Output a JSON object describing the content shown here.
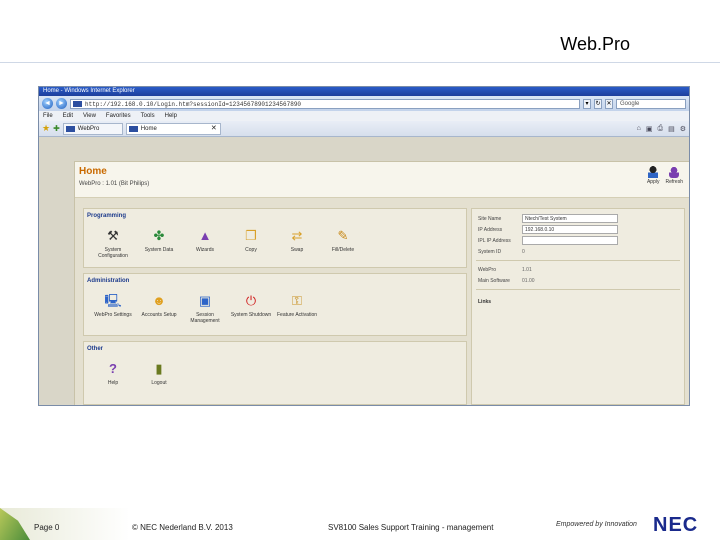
{
  "slide": {
    "title": "Web.Pro",
    "footer": {
      "page": "Page 0",
      "copyright": "© NEC Nederland B.V.  2013",
      "training": "SV8100 Sales Support Training - management",
      "tagline": "Empowered by Innovation",
      "logo": "NEC"
    }
  },
  "browser": {
    "window_title": "Home - Windows Internet Explorer",
    "url": "http://192.168.0.10/Login.htm?sessionId=12345678901234567890",
    "search_placeholder": "Google",
    "menu": [
      "File",
      "Edit",
      "View",
      "Favorites",
      "Tools",
      "Help"
    ],
    "tabs": [
      {
        "label": "WebPro"
      },
      {
        "label": "Home"
      }
    ]
  },
  "page": {
    "title": "Home",
    "subtitle": "WebPro : 1.01 (Bit Philips)",
    "actions": {
      "apply": "Apply",
      "refresh": "Refresh"
    },
    "programming": {
      "title": "Programming",
      "items": [
        {
          "label": "System Configuration",
          "icon": "tools-icon"
        },
        {
          "label": "System Data",
          "icon": "blocks-icon"
        },
        {
          "label": "Wizards",
          "icon": "wizard-icon"
        },
        {
          "label": "Copy",
          "icon": "copy-icon"
        },
        {
          "label": "Swap",
          "icon": "swap-icon"
        },
        {
          "label": "Fill/Delete",
          "icon": "fill-delete-icon"
        }
      ]
    },
    "administration": {
      "title": "Administration",
      "items": [
        {
          "label": "WebPro Settings",
          "icon": "computer-icon"
        },
        {
          "label": "Accounts Setup",
          "icon": "users-icon"
        },
        {
          "label": "Session Management",
          "icon": "session-icon"
        },
        {
          "label": "System Shutdown",
          "icon": "power-icon"
        },
        {
          "label": "Feature Activation",
          "icon": "keys-icon"
        }
      ]
    },
    "other": {
      "title": "Other",
      "items": [
        {
          "label": "Help",
          "icon": "help-icon"
        },
        {
          "label": "Logout",
          "icon": "door-icon"
        }
      ]
    },
    "info": {
      "site_name_label": "Site Name",
      "site_name_value": "Ntech/Test System",
      "ip_label": "IP Address",
      "ip_value": "192.168.0.10",
      "ipl_label": "IPL IP Address",
      "ipl_value": "",
      "system_id_label": "System ID",
      "system_id_value": "0",
      "webpro_label": "WebPro",
      "webpro_value": "1.01",
      "main_sw_label": "Main Software",
      "main_sw_value": "01.00",
      "links_label": "Links"
    }
  }
}
